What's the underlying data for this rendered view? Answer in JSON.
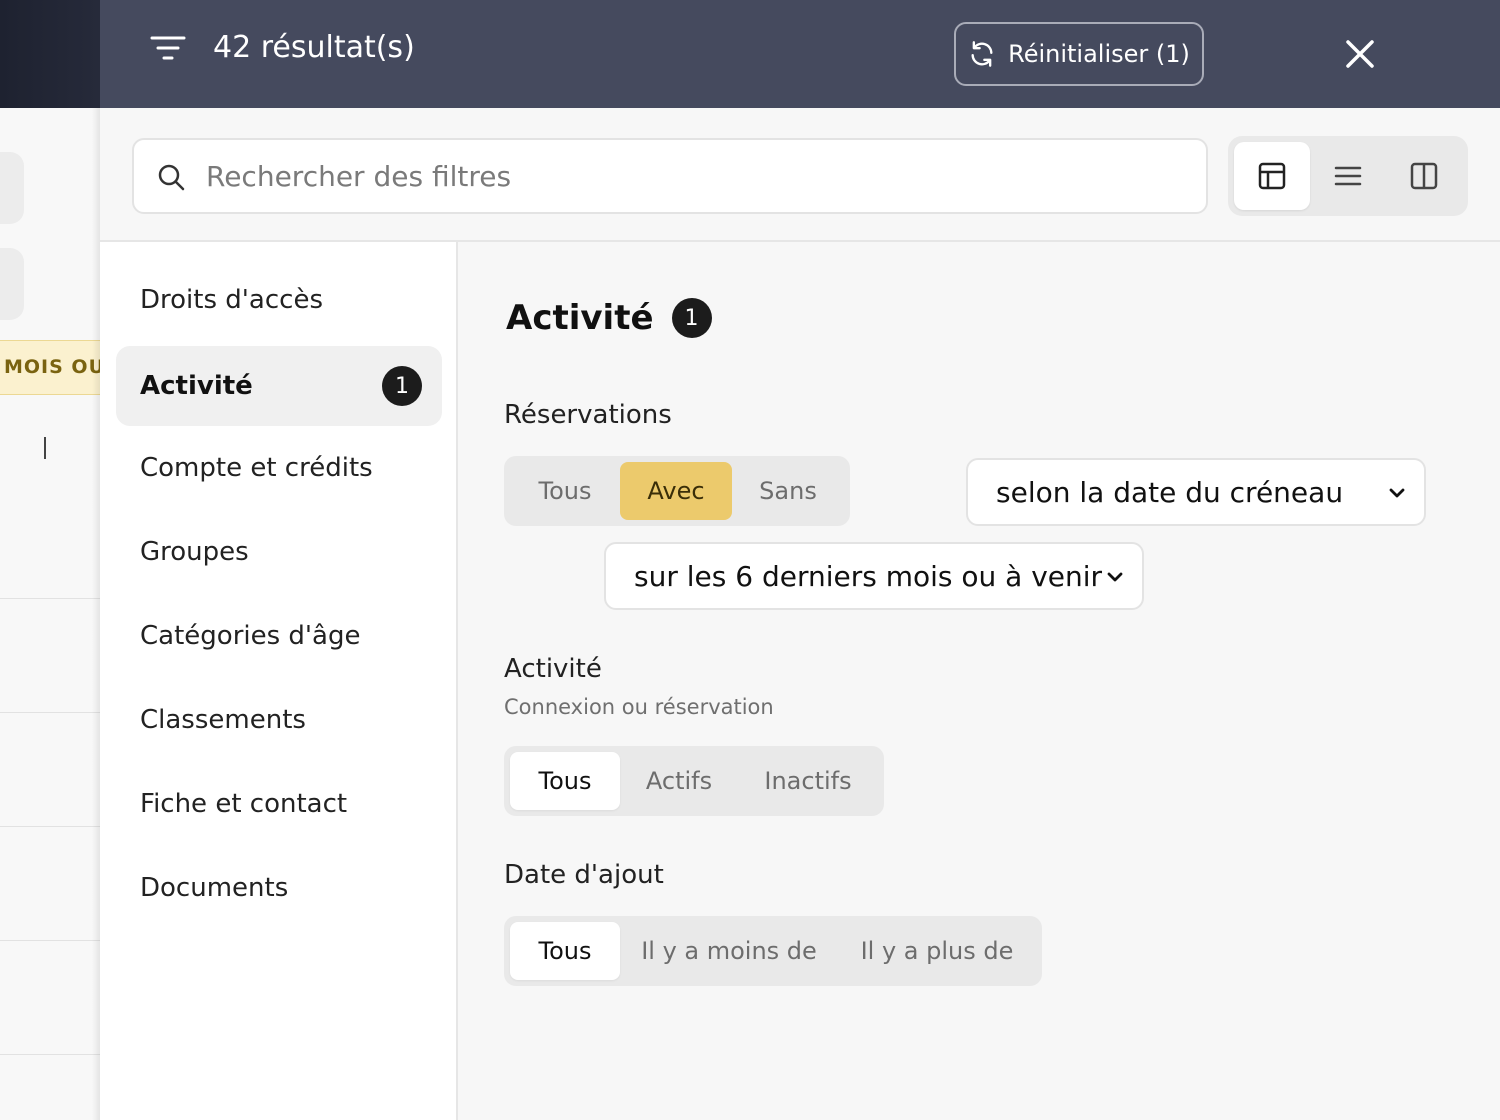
{
  "background": {
    "badge_text": "MOIS OU",
    "bar_text": "|"
  },
  "header": {
    "results": "42 résultat(s)",
    "reset_label": "Réinitialiser (1)"
  },
  "search": {
    "placeholder": "Rechercher des filtres"
  },
  "view_modes": [
    {
      "icon": "layout-panel-icon",
      "active": true
    },
    {
      "icon": "list-icon",
      "active": false
    },
    {
      "icon": "columns-icon",
      "active": false
    }
  ],
  "sidebar": {
    "items": [
      {
        "label": "Droits d'accès"
      },
      {
        "label": "Activité",
        "count": "1",
        "active": true
      },
      {
        "label": "Compte et crédits"
      },
      {
        "label": "Groupes"
      },
      {
        "label": "Catégories d'âge"
      },
      {
        "label": "Classements"
      },
      {
        "label": "Fiche et contact"
      },
      {
        "label": "Documents"
      }
    ]
  },
  "main": {
    "title": "Activité",
    "title_count": "1",
    "reservations": {
      "label": "Réservations",
      "options": [
        "Tous",
        "Avec",
        "Sans"
      ],
      "selected": "Avec",
      "date_basis": "selon la date du créneau",
      "period": "sur les 6 derniers mois ou à venir"
    },
    "activity": {
      "label": "Activité",
      "sublabel": "Connexion ou réservation",
      "options": [
        "Tous",
        "Actifs",
        "Inactifs"
      ],
      "selected": "Tous"
    },
    "date_added": {
      "label": "Date d'ajout",
      "options": [
        "Tous",
        "Il y a moins de",
        "Il y a plus de"
      ],
      "selected": "Tous"
    }
  },
  "colors": {
    "header_bg": "#454a5e",
    "accent_yellow": "#ecca6c",
    "badge_dark": "#1c1c1c"
  }
}
